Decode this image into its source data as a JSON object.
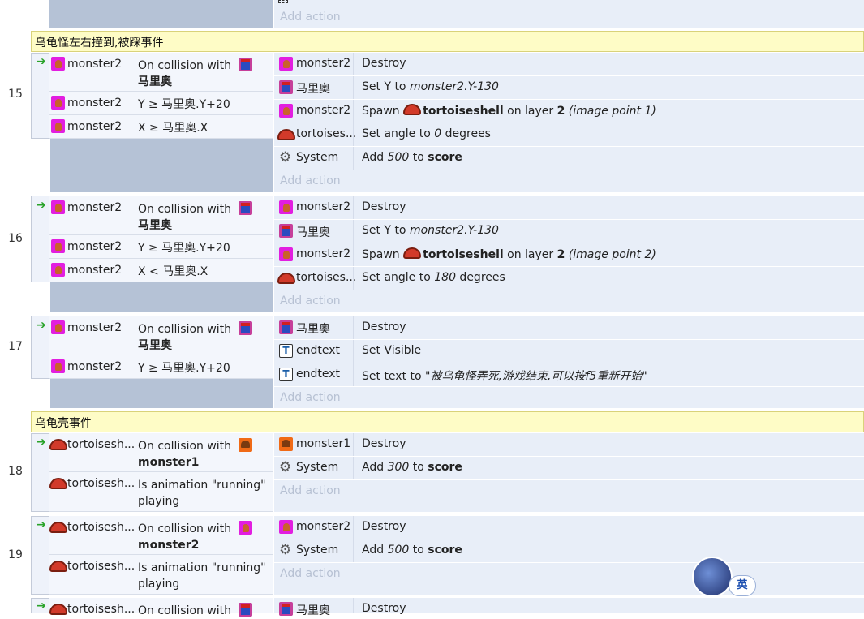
{
  "top": {
    "add_action": "Add action"
  },
  "groups": [
    {
      "title": "乌龟怪左右撞到,被踩事件"
    },
    {
      "title": "乌龟壳事件"
    }
  ],
  "events": [
    {
      "num": "15",
      "conditions": [
        {
          "object": "monster2",
          "text": "On collision with",
          "target": "马里奥"
        },
        {
          "object": "monster2",
          "text": "Y ≥ 马里奥.Y+20"
        },
        {
          "object": "monster2",
          "text": "X ≥ 马里奥.X"
        }
      ],
      "actions": [
        {
          "object": "monster2",
          "text_pre": "Destroy"
        },
        {
          "object": "马里奥",
          "text_pre": "Set Y to ",
          "italic": "monster2.Y-130"
        },
        {
          "object": "monster2",
          "text_pre": "Spawn ",
          "bold": "tortoiseshell",
          "mid": " on layer ",
          "bold2": "2",
          "italic": " (image point 1)"
        },
        {
          "object": "tortoises...",
          "text_pre": "Set angle to ",
          "italic": "0",
          "post": " degrees"
        },
        {
          "object": "System",
          "text_pre": "Add ",
          "italic": "500",
          "mid": " to ",
          "bold": "score"
        }
      ],
      "add_action": "Add action"
    },
    {
      "num": "16",
      "conditions": [
        {
          "object": "monster2",
          "text": "On collision with",
          "target": "马里奥"
        },
        {
          "object": "monster2",
          "text": "Y ≥ 马里奥.Y+20"
        },
        {
          "object": "monster2",
          "text": "X < 马里奥.X"
        }
      ],
      "actions": [
        {
          "object": "monster2",
          "text_pre": "Destroy"
        },
        {
          "object": "马里奥",
          "text_pre": "Set Y to ",
          "italic": "monster2.Y-130"
        },
        {
          "object": "monster2",
          "text_pre": "Spawn ",
          "bold": "tortoiseshell",
          "mid": " on layer ",
          "bold2": "2",
          "italic": " (image point 2)"
        },
        {
          "object": "tortoises...",
          "text_pre": "Set angle to ",
          "italic": "180",
          "post": " degrees"
        }
      ],
      "add_action": "Add action"
    },
    {
      "num": "17",
      "conditions": [
        {
          "object": "monster2",
          "text": "On collision with",
          "target": "马里奥"
        },
        {
          "object": "monster2",
          "text": "Y ≥ 马里奥.Y+20"
        }
      ],
      "actions": [
        {
          "object": "马里奥",
          "text_pre": "Destroy"
        },
        {
          "object": "endtext",
          "text_pre": "Set Visible"
        },
        {
          "object": "endtext",
          "text_pre": "Set text to \"",
          "italic": "被乌龟怪弄死,游戏结束,可以按f5重新开始",
          "post": "\""
        }
      ],
      "add_action": "Add action"
    },
    {
      "num": "18",
      "conditions": [
        {
          "object": "tortoisesh...",
          "text": "On collision with",
          "target": "monster1"
        },
        {
          "object": "tortoisesh...",
          "text": "Is animation \"running\" playing"
        }
      ],
      "actions": [
        {
          "object": "monster1",
          "text_pre": "Destroy"
        },
        {
          "object": "System",
          "text_pre": "Add ",
          "italic": "300",
          "mid": " to ",
          "bold": "score"
        }
      ],
      "add_action": "Add action"
    },
    {
      "num": "19",
      "conditions": [
        {
          "object": "tortoisesh...",
          "text": "On collision with",
          "target": "monster2"
        },
        {
          "object": "tortoisesh...",
          "text": "Is animation \"running\" playing"
        }
      ],
      "actions": [
        {
          "object": "monster2",
          "text_pre": "Destroy"
        },
        {
          "object": "System",
          "text_pre": "Add ",
          "italic": "500",
          "mid": " to ",
          "bold": "score"
        }
      ],
      "add_action": "Add action"
    },
    {
      "num": "",
      "conditions": [
        {
          "object": "tortoisesh...",
          "text": "On collision with"
        }
      ],
      "actions": [
        {
          "object": "马里奥",
          "text_pre": "Destroy"
        }
      ]
    }
  ],
  "ime": {
    "label": "英"
  },
  "colors": {
    "group_bg": "#fefcc6",
    "action_bg": "#e8eef8",
    "condition_bg": "#f3f6fc",
    "filler": "#b5c2d6"
  }
}
